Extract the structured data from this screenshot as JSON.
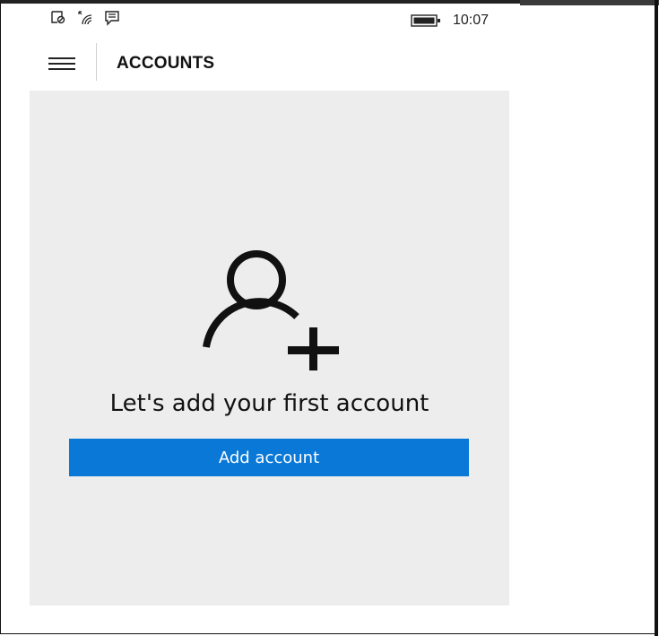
{
  "status": {
    "time": "10:07",
    "icons": [
      "screen-share-icon",
      "wifi-signal-icon",
      "notification-message-icon",
      "battery-icon"
    ]
  },
  "header": {
    "title": "ACCOUNTS",
    "menu_icon": "hamburger-menu-icon"
  },
  "empty_state": {
    "icon": "add-person-icon",
    "message": "Let's add your first account",
    "button_label": "Add account"
  },
  "colors": {
    "accent": "#0978d7",
    "panel": "#ededed",
    "text": "#111111"
  }
}
